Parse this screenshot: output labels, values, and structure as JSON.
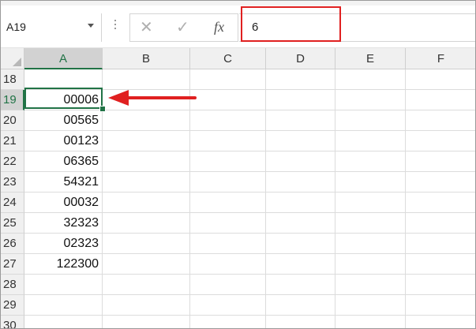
{
  "formula_bar": {
    "name_box": "A19",
    "cancel_glyph": "✕",
    "enter_glyph": "✓",
    "fx_label": "fx",
    "value": "6"
  },
  "columns": [
    "A",
    "B",
    "C",
    "D",
    "E",
    "F"
  ],
  "rows": [
    {
      "num": "18",
      "a": ""
    },
    {
      "num": "19",
      "a": "00006"
    },
    {
      "num": "20",
      "a": "00565"
    },
    {
      "num": "21",
      "a": "00123"
    },
    {
      "num": "22",
      "a": "06365"
    },
    {
      "num": "23",
      "a": "54321"
    },
    {
      "num": "24",
      "a": "00032"
    },
    {
      "num": "25",
      "a": "32323"
    },
    {
      "num": "26",
      "a": "02323"
    },
    {
      "num": "27",
      "a": "122300"
    },
    {
      "num": "28",
      "a": ""
    },
    {
      "num": "29",
      "a": ""
    },
    {
      "num": "30",
      "a": ""
    }
  ],
  "selection": {
    "column": "A",
    "row": "19"
  },
  "colors": {
    "accent": "#217346",
    "highlight": "#e02020"
  }
}
